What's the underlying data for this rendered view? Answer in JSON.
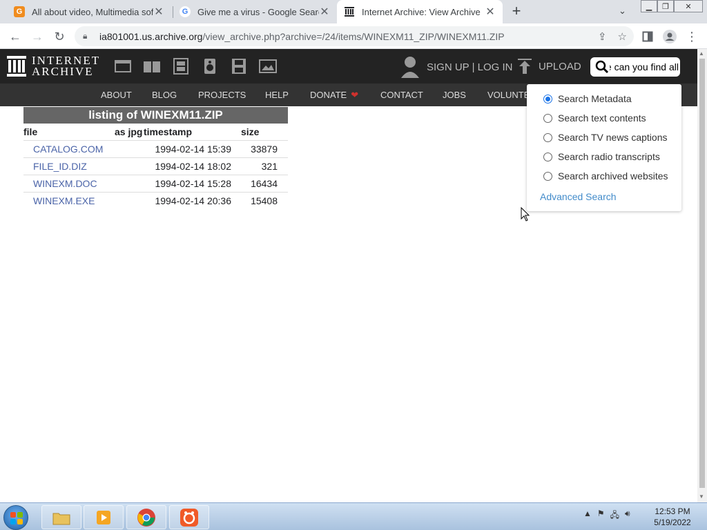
{
  "browser": {
    "tabs": [
      {
        "title": "All about video, Multimedia softw",
        "favicon": "G",
        "favicon_color": "#f08c1e"
      },
      {
        "title": "Give me a virus - Google Search",
        "favicon": "G",
        "favicon_color": "#4285f4"
      },
      {
        "title": "Internet Archive: View Archive",
        "favicon": "archive-icon",
        "favicon_color": "#202124"
      }
    ],
    "url_host": "ia801001.us.archive.org",
    "url_rest": "/view_archive.php?archive=/24/items/WINEXM11_ZIP/WINEXM11.ZIP"
  },
  "ia": {
    "logo_line1": "INTERNET",
    "logo_line2": "ARCHIVE",
    "signup": "SIGN UP | LOG IN",
    "upload": "UPLOAD",
    "search_value": "e can you find all",
    "nav": [
      "ABOUT",
      "BLOG",
      "PROJECTS",
      "HELP",
      "DONATE",
      "CONTACT",
      "JOBS",
      "VOLUNTE"
    ]
  },
  "listing": {
    "caption": "listing of WINEXM11.ZIP",
    "headers": {
      "file": "file",
      "jpg": "as jpg",
      "timestamp": "timestamp",
      "size": "size"
    },
    "rows": [
      {
        "file": "CATALOG.COM",
        "timestamp": "1994-02-14 15:39",
        "size": "33879"
      },
      {
        "file": "FILE_ID.DIZ",
        "timestamp": "1994-02-14 18:02",
        "size": "321"
      },
      {
        "file": "WINEXM.DOC",
        "timestamp": "1994-02-14 15:28",
        "size": "16434"
      },
      {
        "file": "WINEXM.EXE",
        "timestamp": "1994-02-14 20:36",
        "size": "15408"
      }
    ]
  },
  "search_dropdown": {
    "options": [
      "Search Metadata",
      "Search text contents",
      "Search TV news captions",
      "Search radio transcripts",
      "Search archived websites"
    ],
    "selected": "Search Metadata",
    "advanced": "Advanced Search"
  },
  "taskbar": {
    "time": "12:53 PM",
    "date": "5/19/2022"
  }
}
